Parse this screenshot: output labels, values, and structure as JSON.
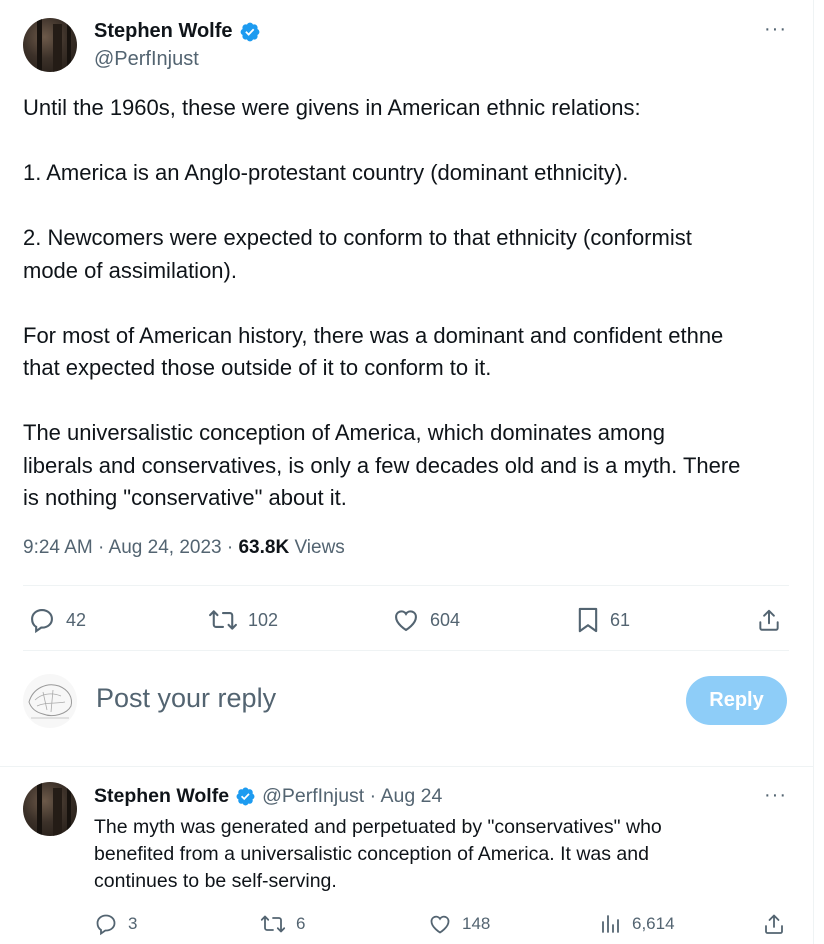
{
  "tweet": {
    "author_name": "Stephen Wolfe",
    "author_handle": "@PerfInjust",
    "paragraphs": [
      "Until the 1960s, these were givens in American ethnic relations:",
      "1. America is an Anglo-protestant country (dominant ethnicity).",
      "2. Newcomers were expected to conform to that ethnicity (conformist\nmode of assimilation).",
      "For most of American history, there was a dominant and confident ethne\nthat expected those outside of it to conform to it.",
      "The universalistic conception of America, which dominates among\nliberals and conservatives, is only a few decades old and is a myth. There\nis nothing \"conservative\" about it."
    ],
    "timestamp": "9:24 AM · Aug 24, 2023 · ",
    "views_count": "63.8K",
    "views_label": " Views",
    "replies": "42",
    "reposts": "102",
    "likes": "604",
    "bookmarks": "61"
  },
  "composer": {
    "placeholder": "Post your reply",
    "button_label": "Reply"
  },
  "reply_tweet": {
    "author_name": "Stephen Wolfe",
    "handle_and_date": "@PerfInjust · Aug 24",
    "text": "The myth was generated and perpetuated by \"conservatives\" who\nbenefited from a universalistic conception of America. It was and\ncontinues to be self-serving.",
    "replies": "3",
    "reposts": "6",
    "likes": "148",
    "views": "6,614"
  },
  "colors": {
    "verified": "#1d9bf0",
    "secondary_text": "#536471",
    "reply_button": "#8ecdf8"
  },
  "icons": [
    "verified-badge-icon",
    "more-icon",
    "reply-icon",
    "repost-icon",
    "like-icon",
    "bookmark-icon",
    "share-icon",
    "views-icon"
  ]
}
